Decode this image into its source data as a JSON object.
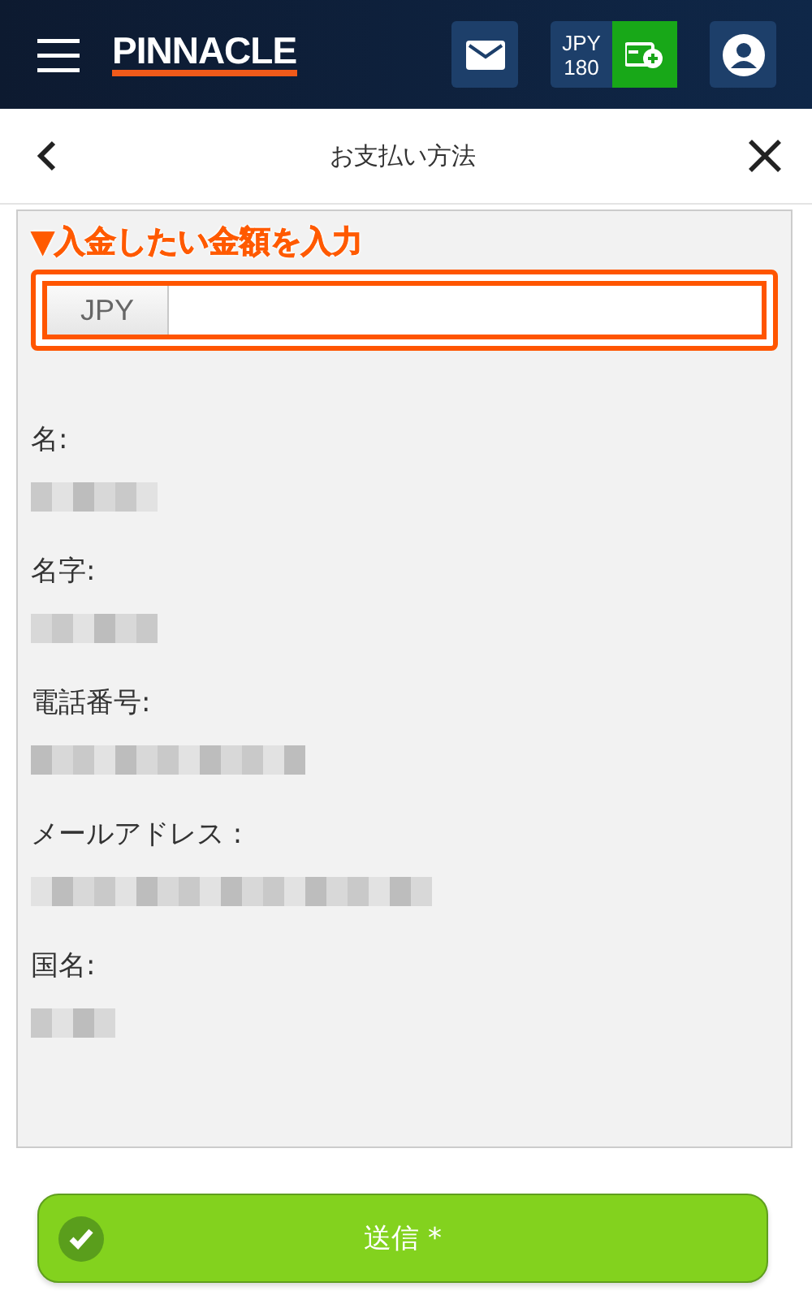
{
  "header": {
    "logo": "PINNACLE",
    "balance": {
      "currency": "JPY",
      "amount": "180"
    }
  },
  "page": {
    "title": "お支払い方法"
  },
  "annotation": "▼入金したい金額を入力",
  "amount_field": {
    "prefix": "JPY"
  },
  "fields": [
    {
      "label": "名:"
    },
    {
      "label": "名字:"
    },
    {
      "label": "電話番号:"
    },
    {
      "label": "メールアドレス :"
    },
    {
      "label": "国名:"
    }
  ],
  "submit": {
    "label": "送信 *"
  }
}
